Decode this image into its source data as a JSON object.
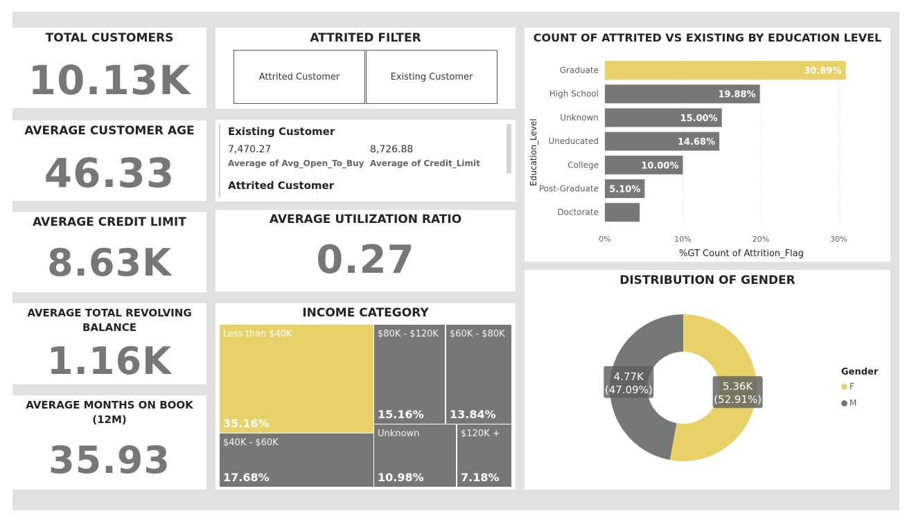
{
  "kpis": {
    "total_customers": {
      "title": "TOTAL CUSTOMERS",
      "value": "10.13K"
    },
    "avg_age": {
      "title": "AVERAGE CUSTOMER AGE",
      "value": "46.33"
    },
    "avg_credit_limit": {
      "title": "AVERAGE CREDIT LIMIT",
      "value": "8.63K"
    },
    "avg_revolving": {
      "title_line1": "AVERAGE TOTAL REVOLVING",
      "title_line2": "BALANCE",
      "value": "1.16K"
    },
    "avg_months": {
      "title_line1": "AVERAGE MONTHS ON BOOK",
      "title_line2": "(12M)",
      "value": "35.93"
    },
    "avg_utilization": {
      "title": "AVERAGE UTILIZATION RATIO",
      "value": "0.27"
    }
  },
  "filter": {
    "title": "ATTRITED FILTER",
    "options": [
      "Attrited Customer",
      "Existing Customer"
    ]
  },
  "multirow": {
    "group1": {
      "name": "Existing Customer",
      "val1": "7,470.27",
      "lbl1": "Average of Avg_Open_To_Buy",
      "val2": "8,726.88",
      "lbl2": "Average of Credit_Limit"
    },
    "group2": {
      "name": "Attrited Customer"
    }
  },
  "income": {
    "title": "INCOME CATEGORY",
    "tiles": [
      {
        "label": "Less than $40K",
        "value": "35.16%"
      },
      {
        "label": "$80K - $120K",
        "value": "15.16%"
      },
      {
        "label": "$60K - $80K",
        "value": "13.84%"
      },
      {
        "label": "$40K - $60K",
        "value": "17.68%"
      },
      {
        "label": "Unknown",
        "value": "10.98%"
      },
      {
        "label": "$120K +",
        "value": "7.18%"
      }
    ]
  },
  "colors": {
    "accent": "#e8d166",
    "grey": "#777777",
    "card": "#ffffff",
    "canvas": "#e1e1e1"
  },
  "chart_data": [
    {
      "type": "bar",
      "orientation": "horizontal",
      "title": "COUNT OF ATTRITED VS EXISTING BY EDUCATION LEVEL",
      "xlabel": "%GT Count of Attrition_Flag",
      "ylabel": "Education_Level",
      "categories": [
        "Graduate",
        "High School",
        "Unknown",
        "Uneducated",
        "College",
        "Post-Graduate",
        "Doctorate"
      ],
      "values": [
        30.89,
        19.88,
        15.0,
        14.68,
        10.0,
        5.1,
        4.46
      ],
      "data_labels": [
        "30.89%",
        "19.88%",
        "15.00%",
        "14.68%",
        "10.00%",
        "5.10%",
        ""
      ],
      "xlim": [
        0,
        33
      ],
      "xticks": [
        0,
        10,
        20,
        30
      ],
      "xtick_labels": [
        "0%",
        "10%",
        "20%",
        "30%"
      ],
      "highlight_index": 0,
      "gridlines": true
    },
    {
      "type": "pie",
      "donut": true,
      "title": "DISTRIBUTION OF GENDER",
      "legend_title": "Gender",
      "legend_position": "right",
      "slices": [
        {
          "name": "F",
          "value": 5.36,
          "label": "5.36K",
          "pct": "(52.91%)",
          "color": "#e8d166"
        },
        {
          "name": "M",
          "value": 4.77,
          "label": "4.77K",
          "pct": "(47.09%)",
          "color": "#777777"
        }
      ]
    }
  ]
}
